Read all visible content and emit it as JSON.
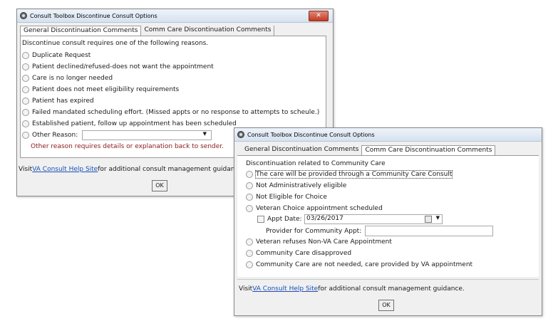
{
  "dialog1": {
    "title": "Consult Toolbox Discontinue Consult Options",
    "close_label": "✕",
    "tabs": [
      "General Discontinuation Comments",
      "Comm Care Discontinuation Comments"
    ],
    "intro": "Discontinue consult requires one of the following reasons.",
    "reasons": [
      "Duplicate Request",
      "Patient declined/refused-does not want the appointment",
      "Care is no longer needed",
      "Patient does not meet eligibility requirements",
      "Patient has expired",
      "Failed mandated scheduling effort. (Missed appts or no response to attempts to scheule.)",
      "Established patient, follow up appointment has been scheduled"
    ],
    "other_label": "Other Reason:",
    "other_value": "",
    "other_hint": "Other reason requires details or explanation back to sender.",
    "footer_prefix": "Visit ",
    "footer_link": "VA Consult Help Site",
    "footer_suffix": " for additional consult management guidance.",
    "ok_label": "OK"
  },
  "dialog2": {
    "title": "Consult Toolbox Discontinue Consult Options",
    "tabs": [
      "General Discontinuation Comments",
      "Comm Care Discontinuation Comments"
    ],
    "intro": "Discontinuation related to Community Care",
    "reasons_top": [
      "The care will be provided through a Community Care Consult",
      "Not Administratively eligible",
      "Not Eligible for Choice",
      "Veteran Choice appointment scheduled"
    ],
    "appt_date_label": "Appt Date:",
    "appt_date_value": "03/26/2017",
    "provider_label": "Provider for Community Appt:",
    "provider_value": "",
    "reasons_bottom": [
      "Veteran refuses Non-VA Care Appointment",
      "Community Care disapproved",
      "Community Care are not needed, care provided by VA appointment"
    ],
    "footer_prefix": "Visit ",
    "footer_link": "VA Consult Help Site",
    "footer_suffix": " for additional consult management guidance.",
    "ok_label": "OK"
  }
}
